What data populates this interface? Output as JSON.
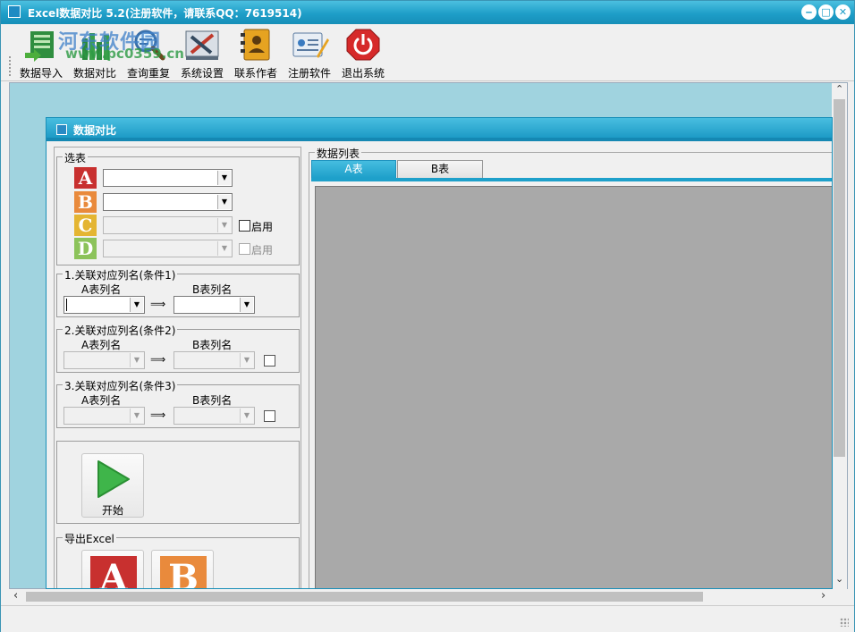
{
  "window": {
    "title": "Excel数据对比 5.2(注册软件，请联系QQ：7619514)",
    "minimize_glyph": "‒",
    "maximize_glyph": "□",
    "close_glyph": "✕"
  },
  "watermark": {
    "line1": "河东软件园",
    "line2": "www.pc0359.cn"
  },
  "toolbar": {
    "items": [
      {
        "label": "数据导入",
        "icon": "import-icon"
      },
      {
        "label": "数据对比",
        "icon": "compare-icon"
      },
      {
        "label": "查询重复",
        "icon": "search-icon"
      },
      {
        "label": "系统设置",
        "icon": "settings-icon"
      },
      {
        "label": "联系作者",
        "icon": "contact-icon"
      },
      {
        "label": "注册软件",
        "icon": "register-icon"
      },
      {
        "label": "退出系统",
        "icon": "power-icon"
      }
    ]
  },
  "scroll": {
    "up": "⌃",
    "down": "⌄",
    "left": "‹",
    "right": "›"
  },
  "compare_window": {
    "title": "数据对比",
    "select_tables": {
      "legend": "选表",
      "letters": [
        "A",
        "B",
        "C",
        "D"
      ],
      "colors": {
        "A": "#c8302f",
        "B": "#e98a3c",
        "C": "#e4b532",
        "D": "#8cc35a"
      },
      "enable_label_c": "启用",
      "enable_label_d": "启用"
    },
    "conditions": [
      {
        "legend": "1.关联对应列名(条件1)",
        "a_col": "A表列名",
        "b_col": "B表列名",
        "arrow": "⟹"
      },
      {
        "legend": "2.关联对应列名(条件2)",
        "a_col": "A表列名",
        "b_col": "B表列名",
        "arrow": "⟹"
      },
      {
        "legend": "3.关联对应列名(条件3)",
        "a_col": "A表列名",
        "b_col": "B表列名",
        "arrow": "⟹"
      }
    ],
    "start_label": "开始",
    "export": {
      "legend": "导出Excel",
      "a_letter": "A",
      "b_letter": "B"
    },
    "data_list": {
      "legend": "数据列表",
      "tabs": [
        "A表",
        "B表"
      ],
      "active_tab": "A表"
    }
  }
}
